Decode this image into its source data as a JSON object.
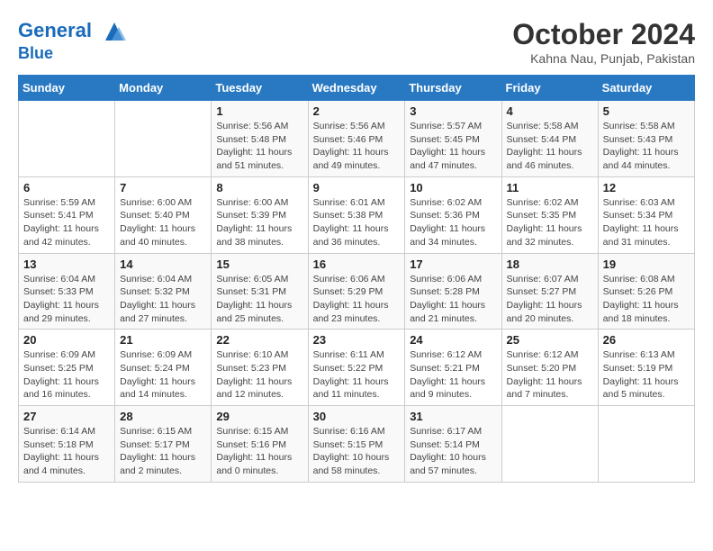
{
  "header": {
    "logo_line1": "General",
    "logo_line2": "Blue",
    "title": "October 2024",
    "location": "Kahna Nau, Punjab, Pakistan"
  },
  "weekdays": [
    "Sunday",
    "Monday",
    "Tuesday",
    "Wednesday",
    "Thursday",
    "Friday",
    "Saturday"
  ],
  "weeks": [
    [
      {
        "day": "",
        "info": ""
      },
      {
        "day": "",
        "info": ""
      },
      {
        "day": "1",
        "info": "Sunrise: 5:56 AM\nSunset: 5:48 PM\nDaylight: 11 hours and 51 minutes."
      },
      {
        "day": "2",
        "info": "Sunrise: 5:56 AM\nSunset: 5:46 PM\nDaylight: 11 hours and 49 minutes."
      },
      {
        "day": "3",
        "info": "Sunrise: 5:57 AM\nSunset: 5:45 PM\nDaylight: 11 hours and 47 minutes."
      },
      {
        "day": "4",
        "info": "Sunrise: 5:58 AM\nSunset: 5:44 PM\nDaylight: 11 hours and 46 minutes."
      },
      {
        "day": "5",
        "info": "Sunrise: 5:58 AM\nSunset: 5:43 PM\nDaylight: 11 hours and 44 minutes."
      }
    ],
    [
      {
        "day": "6",
        "info": "Sunrise: 5:59 AM\nSunset: 5:41 PM\nDaylight: 11 hours and 42 minutes."
      },
      {
        "day": "7",
        "info": "Sunrise: 6:00 AM\nSunset: 5:40 PM\nDaylight: 11 hours and 40 minutes."
      },
      {
        "day": "8",
        "info": "Sunrise: 6:00 AM\nSunset: 5:39 PM\nDaylight: 11 hours and 38 minutes."
      },
      {
        "day": "9",
        "info": "Sunrise: 6:01 AM\nSunset: 5:38 PM\nDaylight: 11 hours and 36 minutes."
      },
      {
        "day": "10",
        "info": "Sunrise: 6:02 AM\nSunset: 5:36 PM\nDaylight: 11 hours and 34 minutes."
      },
      {
        "day": "11",
        "info": "Sunrise: 6:02 AM\nSunset: 5:35 PM\nDaylight: 11 hours and 32 minutes."
      },
      {
        "day": "12",
        "info": "Sunrise: 6:03 AM\nSunset: 5:34 PM\nDaylight: 11 hours and 31 minutes."
      }
    ],
    [
      {
        "day": "13",
        "info": "Sunrise: 6:04 AM\nSunset: 5:33 PM\nDaylight: 11 hours and 29 minutes."
      },
      {
        "day": "14",
        "info": "Sunrise: 6:04 AM\nSunset: 5:32 PM\nDaylight: 11 hours and 27 minutes."
      },
      {
        "day": "15",
        "info": "Sunrise: 6:05 AM\nSunset: 5:31 PM\nDaylight: 11 hours and 25 minutes."
      },
      {
        "day": "16",
        "info": "Sunrise: 6:06 AM\nSunset: 5:29 PM\nDaylight: 11 hours and 23 minutes."
      },
      {
        "day": "17",
        "info": "Sunrise: 6:06 AM\nSunset: 5:28 PM\nDaylight: 11 hours and 21 minutes."
      },
      {
        "day": "18",
        "info": "Sunrise: 6:07 AM\nSunset: 5:27 PM\nDaylight: 11 hours and 20 minutes."
      },
      {
        "day": "19",
        "info": "Sunrise: 6:08 AM\nSunset: 5:26 PM\nDaylight: 11 hours and 18 minutes."
      }
    ],
    [
      {
        "day": "20",
        "info": "Sunrise: 6:09 AM\nSunset: 5:25 PM\nDaylight: 11 hours and 16 minutes."
      },
      {
        "day": "21",
        "info": "Sunrise: 6:09 AM\nSunset: 5:24 PM\nDaylight: 11 hours and 14 minutes."
      },
      {
        "day": "22",
        "info": "Sunrise: 6:10 AM\nSunset: 5:23 PM\nDaylight: 11 hours and 12 minutes."
      },
      {
        "day": "23",
        "info": "Sunrise: 6:11 AM\nSunset: 5:22 PM\nDaylight: 11 hours and 11 minutes."
      },
      {
        "day": "24",
        "info": "Sunrise: 6:12 AM\nSunset: 5:21 PM\nDaylight: 11 hours and 9 minutes."
      },
      {
        "day": "25",
        "info": "Sunrise: 6:12 AM\nSunset: 5:20 PM\nDaylight: 11 hours and 7 minutes."
      },
      {
        "day": "26",
        "info": "Sunrise: 6:13 AM\nSunset: 5:19 PM\nDaylight: 11 hours and 5 minutes."
      }
    ],
    [
      {
        "day": "27",
        "info": "Sunrise: 6:14 AM\nSunset: 5:18 PM\nDaylight: 11 hours and 4 minutes."
      },
      {
        "day": "28",
        "info": "Sunrise: 6:15 AM\nSunset: 5:17 PM\nDaylight: 11 hours and 2 minutes."
      },
      {
        "day": "29",
        "info": "Sunrise: 6:15 AM\nSunset: 5:16 PM\nDaylight: 11 hours and 0 minutes."
      },
      {
        "day": "30",
        "info": "Sunrise: 6:16 AM\nSunset: 5:15 PM\nDaylight: 10 hours and 58 minutes."
      },
      {
        "day": "31",
        "info": "Sunrise: 6:17 AM\nSunset: 5:14 PM\nDaylight: 10 hours and 57 minutes."
      },
      {
        "day": "",
        "info": ""
      },
      {
        "day": "",
        "info": ""
      }
    ]
  ]
}
